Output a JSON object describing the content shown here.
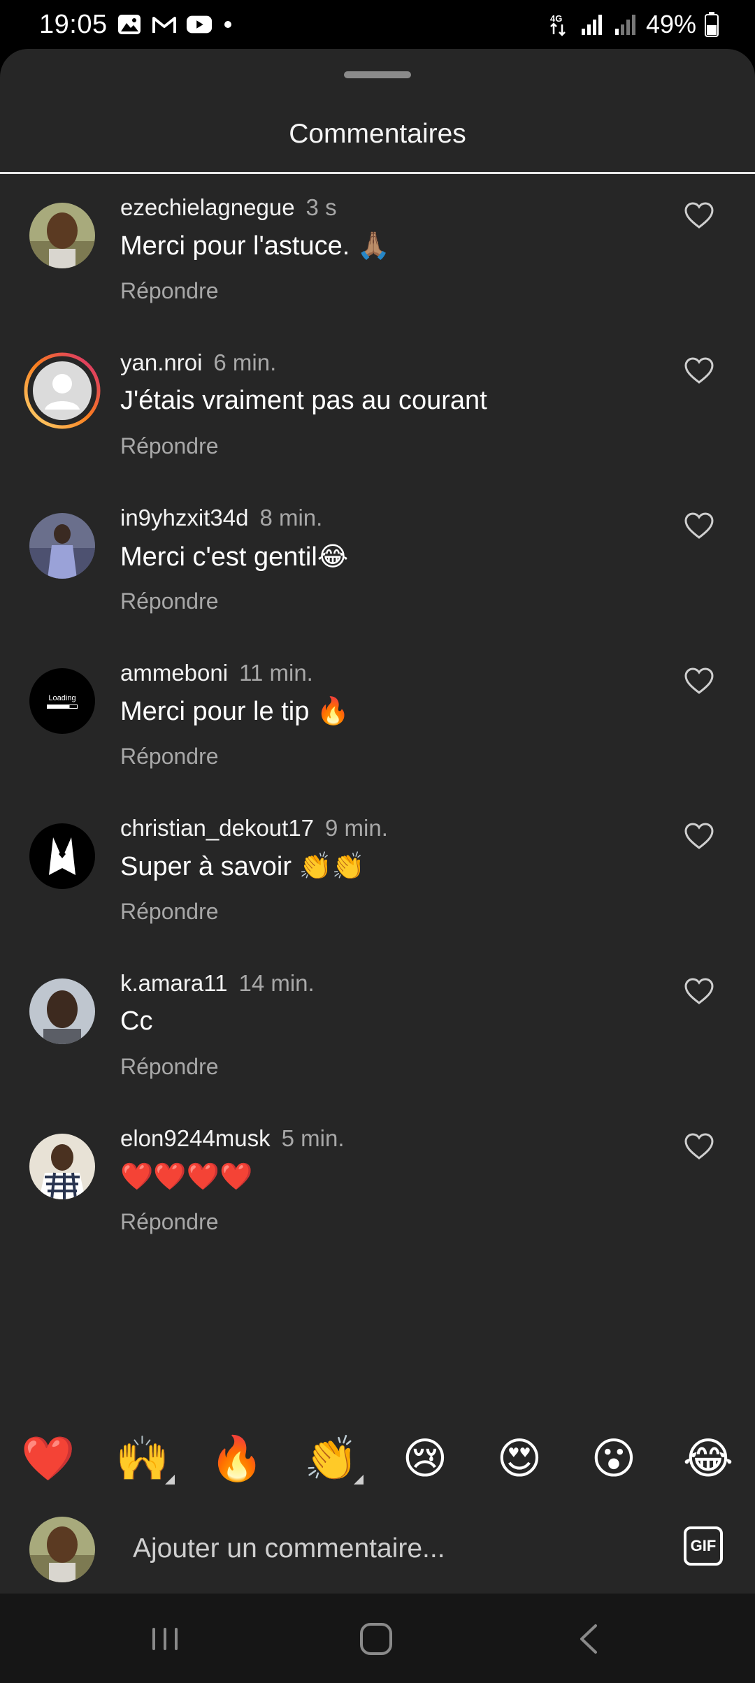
{
  "status_bar": {
    "time": "19:05",
    "battery": "49%",
    "network": "4G",
    "icons": [
      "gallery-icon",
      "gmail-icon",
      "youtube-icon",
      "dot-icon",
      "signal-icon",
      "battery-icon"
    ]
  },
  "sheet": {
    "title": "Commentaires"
  },
  "comments": [
    {
      "username": "ezechielagnegue",
      "time": "3 s",
      "text": "Merci pour l'astuce. 🙏🏽",
      "reply": "Répondre"
    },
    {
      "username": "yan.nroi",
      "time": "6 min.",
      "text": "J'étais vraiment pas au courant",
      "reply": "Répondre"
    },
    {
      "username": "in9yhzxit34d",
      "time": "8 min.",
      "text": "Merci c'est gentil😂",
      "reply": "Répondre"
    },
    {
      "username": "ammeboni",
      "time": "11 min.",
      "text": "Merci pour le tip 🔥",
      "reply": "Répondre",
      "avatar_text": "Loading"
    },
    {
      "username": "christian_dekout17",
      "time": "9 min.",
      "text": "Super à savoir 👏👏",
      "reply": "Répondre"
    },
    {
      "username": "k.amara11",
      "time": "14 min.",
      "text": "Cc",
      "reply": "Répondre"
    },
    {
      "username": "elon9244musk",
      "time": "5 min.",
      "text": "❤️❤️❤️❤️",
      "reply": "Répondre"
    }
  ],
  "reactions": [
    "❤️",
    "🙌",
    "🔥",
    "👏",
    "😢",
    "😍",
    "😮",
    "😂"
  ],
  "input": {
    "placeholder": "Ajouter un commentaire...",
    "gif_label": "GIF"
  },
  "colors": {
    "sheet_bg": "#262626",
    "story_ring_start": "#d62976",
    "story_ring_end": "#feda75"
  }
}
